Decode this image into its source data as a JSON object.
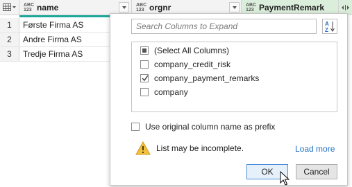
{
  "table": {
    "columns": [
      {
        "type_badge": "ABC 123",
        "name": "name"
      },
      {
        "type_badge": "ABC 123",
        "name": "orgnr"
      },
      {
        "type_badge": "ABC 123",
        "name": "PaymentRemark"
      }
    ],
    "rows": [
      {
        "num": "1",
        "name": "Første Firma AS"
      },
      {
        "num": "2",
        "name": "Andre Firma AS"
      },
      {
        "num": "3",
        "name": "Tredje Firma AS"
      }
    ]
  },
  "expand_popup": {
    "search_placeholder": "Search Columns to Expand",
    "items": [
      {
        "label": "(Select All Columns)",
        "state": "partial"
      },
      {
        "label": "company_credit_risk",
        "state": "unchecked"
      },
      {
        "label": "company_payment_remarks",
        "state": "checked"
      },
      {
        "label": "company",
        "state": "unchecked"
      }
    ],
    "prefix_label": "Use original column name as prefix",
    "prefix_checked": false,
    "warning_text": "List may be incomplete.",
    "load_more": "Load more",
    "ok_label": "OK",
    "cancel_label": "Cancel"
  },
  "colors": {
    "accent_green": "#1ca79a",
    "selected_header": "#dbeedb",
    "link": "#1e6fc5",
    "warning": "#e8b830"
  }
}
